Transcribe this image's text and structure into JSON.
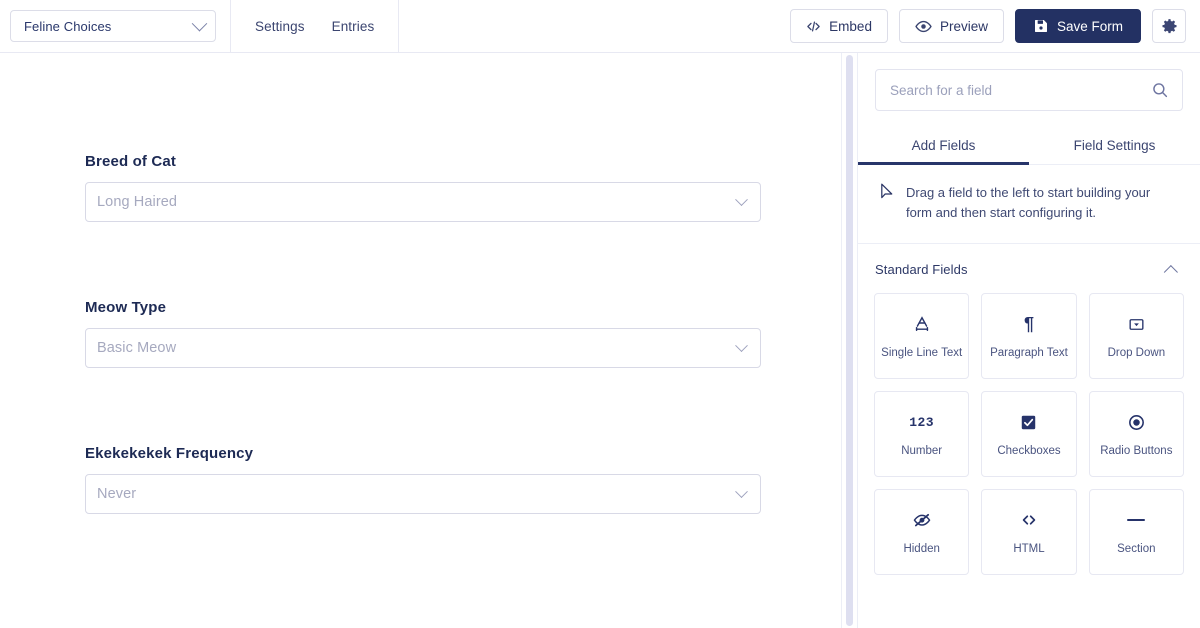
{
  "topbar": {
    "form_selector": {
      "value": "Feline Choices",
      "icon": "chevron-down-icon"
    },
    "nav": [
      {
        "label": "Settings"
      },
      {
        "label": "Entries"
      }
    ],
    "actions": {
      "embed": {
        "label": "Embed",
        "icon": "code-icon"
      },
      "preview": {
        "label": "Preview",
        "icon": "eye-icon"
      },
      "save": {
        "label": "Save Form",
        "icon": "floppy-disk-icon",
        "color": "#233163"
      },
      "settings": {
        "icon": "gear-icon"
      }
    }
  },
  "canvas": {
    "fields": [
      {
        "label": "Breed of Cat",
        "placeholder": "Long Haired",
        "icon": "chevron-down-icon"
      },
      {
        "label": "Meow Type",
        "placeholder": "Basic Meow",
        "icon": "chevron-down-icon"
      },
      {
        "label": "Ekekekekek Frequency",
        "placeholder": "Never",
        "icon": "chevron-down-icon"
      }
    ]
  },
  "sidebar": {
    "search": {
      "placeholder": "Search for a field",
      "value": "",
      "icon": "search-icon"
    },
    "tabs": [
      {
        "label": "Add Fields",
        "active": true
      },
      {
        "label": "Field Settings",
        "active": false
      }
    ],
    "hint": {
      "icon": "cursor-arrow-icon",
      "text": "Drag a field to the left to start building your form and then start configuring it."
    },
    "section": {
      "title": "Standard Fields",
      "collapse_icon": "chevron-up-icon",
      "fields": [
        {
          "label": "Single Line Text",
          "icon": "underlined-a-icon"
        },
        {
          "label": "Paragraph Text",
          "icon": "pilcrow-icon"
        },
        {
          "label": "Drop Down",
          "icon": "dropdown-box-icon"
        },
        {
          "label": "Number",
          "icon": "digits-123-icon"
        },
        {
          "label": "Checkboxes",
          "icon": "checkbox-checked-icon"
        },
        {
          "label": "Radio Buttons",
          "icon": "radio-selected-icon"
        },
        {
          "label": "Hidden",
          "icon": "eye-slash-icon"
        },
        {
          "label": "HTML",
          "icon": "angle-brackets-icon"
        },
        {
          "label": "Section",
          "icon": "horizontal-rule-icon"
        }
      ]
    }
  },
  "theme": {
    "accent": "#233163",
    "border": "#e3e4ef",
    "muted_text": "#a6a9bf"
  }
}
